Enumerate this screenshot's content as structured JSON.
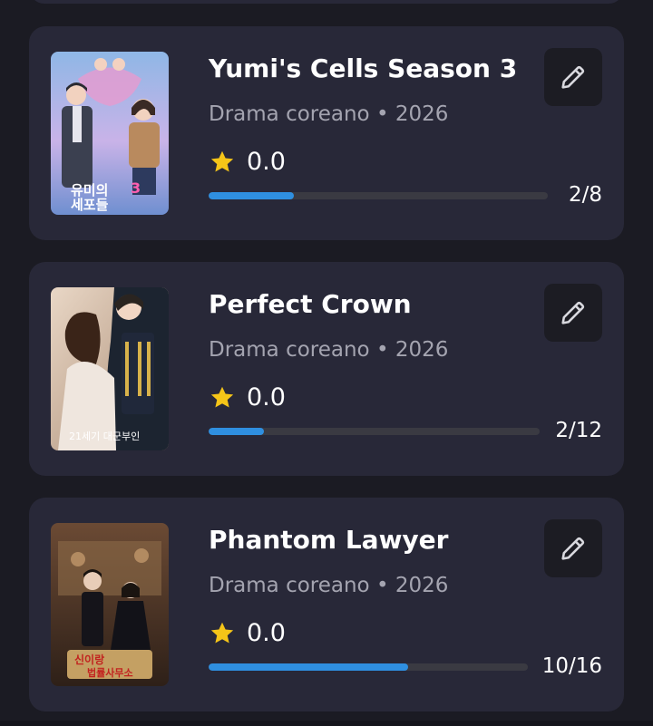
{
  "colors": {
    "background": "#1b1b23",
    "card": "#282838",
    "edit_button": "#1c1c23",
    "progress_fill": "#2f8fe0",
    "progress_track": "#3a3a42",
    "star": "#f5c518",
    "meta_text": "#a4a4b0"
  },
  "cards": [
    {
      "title": "Yumi's Cells Season 3",
      "meta": "Drama coreano • 2026",
      "rating": "0.0",
      "episodes": "2/8",
      "progress": 0.25,
      "poster_icon": "poster-image"
    },
    {
      "title": "Perfect Crown",
      "meta": "Drama coreano • 2026",
      "rating": "0.0",
      "episodes": "2/12",
      "progress": 0.167,
      "poster_icon": "poster-image"
    },
    {
      "title": "Phantom Lawyer",
      "meta": "Drama coreano • 2026",
      "rating": "0.0",
      "episodes": "10/16",
      "progress": 0.625,
      "poster_icon": "poster-image"
    }
  ],
  "icons": {
    "edit": "pencil-icon",
    "rating": "star-icon"
  }
}
